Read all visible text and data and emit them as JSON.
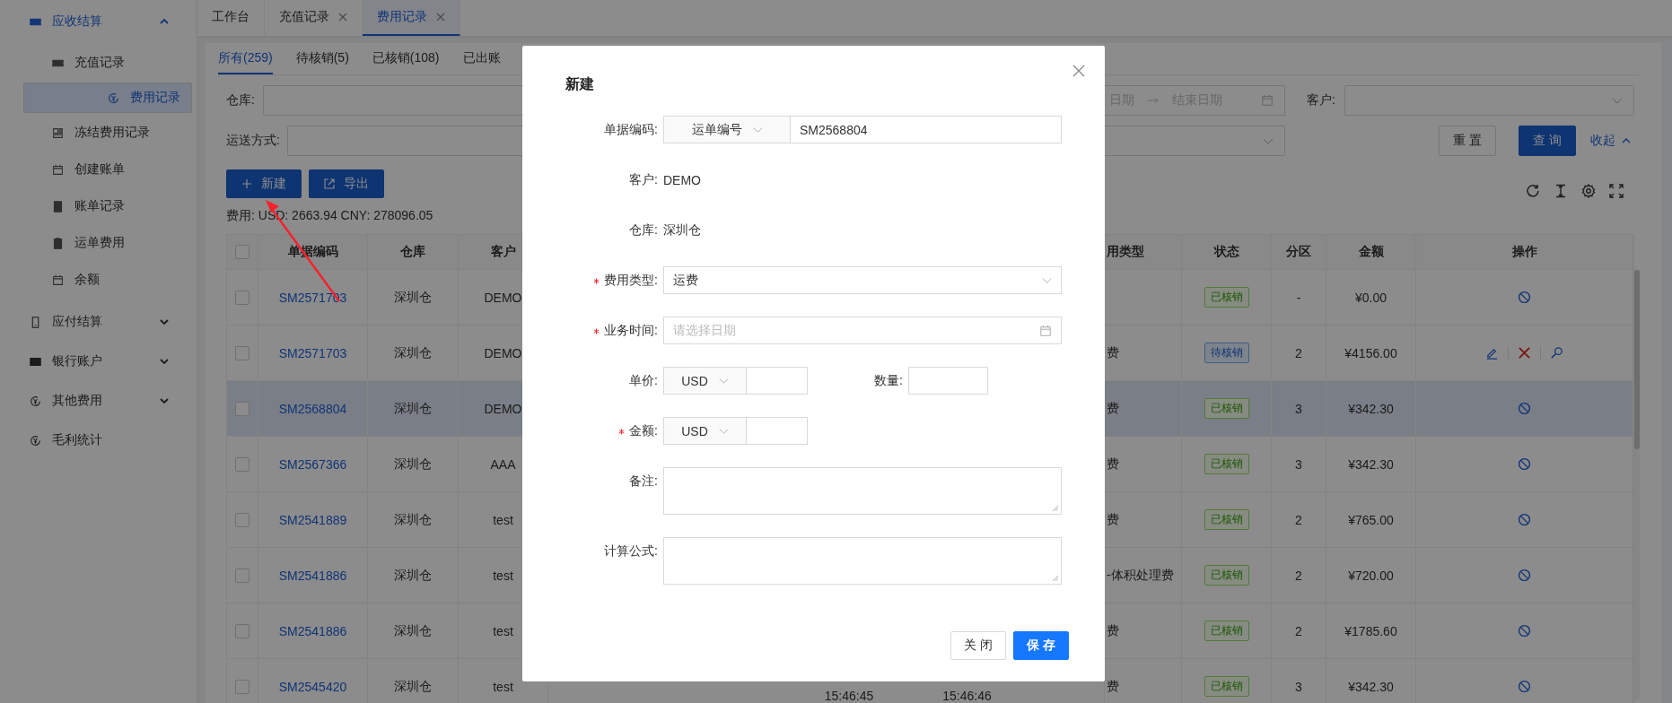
{
  "sidebar": {
    "groups": [
      {
        "label": "应收结算",
        "expanded": true,
        "children": [
          {
            "label": "充值记录",
            "selected": false
          },
          {
            "label": "费用记录",
            "selected": true
          },
          {
            "label": "冻结费用记录",
            "selected": false
          },
          {
            "label": "创建账单",
            "selected": false
          },
          {
            "label": "账单记录",
            "selected": false
          },
          {
            "label": "运单费用",
            "selected": false
          },
          {
            "label": "余额",
            "selected": false
          }
        ]
      },
      {
        "label": "应付结算",
        "expanded": false
      },
      {
        "label": "银行账户",
        "expanded": false
      },
      {
        "label": "其他费用",
        "expanded": false
      },
      {
        "label": "毛利统计"
      }
    ]
  },
  "tabs": [
    {
      "label": "工作台",
      "selected": false,
      "closable": false
    },
    {
      "label": "充值记录",
      "selected": false,
      "closable": true
    },
    {
      "label": "费用记录",
      "selected": true,
      "closable": true
    }
  ],
  "subtabs": [
    {
      "label": "所有(259)",
      "selected": true
    },
    {
      "label": "待核销(5)",
      "selected": false
    },
    {
      "label": "已核销(108)",
      "selected": false
    },
    {
      "label": "已出账",
      "selected": false
    }
  ],
  "filters": {
    "warehouse_label": "仓库:",
    "start_placeholder": "日期",
    "end_placeholder": "结束日期",
    "customer_label": "客户:",
    "shipping_label": "运送方式:",
    "reset": "重 置",
    "query": "查 询",
    "collapse": "收起"
  },
  "toolbar": {
    "new": "新建",
    "export": "导出"
  },
  "summary": "费用: USD: 2663.94 CNY: 278096.05",
  "table": {
    "all_checked": false,
    "columns": [
      "单据编码",
      "仓库",
      "客户",
      "用类型",
      "状态",
      "分区",
      "金额",
      "操作"
    ],
    "rows": [
      {
        "checked": false,
        "selected": false,
        "code": "SM2571703",
        "warehouse": "深圳仓",
        "customer": "DEMO",
        "fee_type": "",
        "status": {
          "label": "已核销",
          "kind": "verified"
        },
        "zone": "-",
        "amount": "¥0.00",
        "editable": false
      },
      {
        "checked": false,
        "selected": false,
        "code": "SM2571703",
        "warehouse": "深圳仓",
        "customer": "DEMO",
        "fee_type": "费",
        "status": {
          "label": "待核销",
          "kind": "pending"
        },
        "zone": "2",
        "amount": "¥4156.00",
        "editable": true
      },
      {
        "checked": false,
        "selected": true,
        "code": "SM2568804",
        "warehouse": "深圳仓",
        "customer": "DEMO",
        "fee_type": "费",
        "status": {
          "label": "已核销",
          "kind": "verified"
        },
        "zone": "3",
        "amount": "¥342.30",
        "editable": false
      },
      {
        "checked": false,
        "selected": false,
        "code": "SM2567366",
        "warehouse": "深圳仓",
        "customer": "AAA",
        "fee_type": "费",
        "status": {
          "label": "已核销",
          "kind": "verified"
        },
        "zone": "3",
        "amount": "¥342.30",
        "editable": false
      },
      {
        "checked": false,
        "selected": false,
        "code": "SM2541889",
        "warehouse": "深圳仓",
        "customer": "test",
        "fee_type": "费",
        "status": {
          "label": "已核销",
          "kind": "verified"
        },
        "zone": "2",
        "amount": "¥765.00",
        "editable": false
      },
      {
        "checked": false,
        "selected": false,
        "code": "SM2541886",
        "warehouse": "深圳仓",
        "customer": "test",
        "fee_type": "-体积处理费",
        "status": {
          "label": "已核销",
          "kind": "verified"
        },
        "zone": "2",
        "amount": "¥720.00",
        "editable": false
      },
      {
        "checked": false,
        "selected": false,
        "code": "SM2541886",
        "warehouse": "深圳仓",
        "customer": "test",
        "fee_type": "费",
        "status": {
          "label": "已核销",
          "kind": "verified"
        },
        "zone": "2",
        "amount": "¥1785.60",
        "editable": false
      },
      {
        "checked": false,
        "selected": false,
        "code": "SM2545420",
        "warehouse": "深圳仓",
        "customer": "test",
        "times": [
          "15:46:45",
          "15:46:46"
        ],
        "fee_type": "费",
        "status": {
          "label": "已核销",
          "kind": "verified"
        },
        "zone": "3",
        "amount": "¥342.30",
        "editable": false
      }
    ]
  },
  "modal": {
    "title": "新建",
    "fields": [
      {
        "kind": "code",
        "label": "单据编码:",
        "required": false,
        "prefix": "运单编号",
        "value": "SM2568804"
      },
      {
        "kind": "text",
        "label": "客户:",
        "required": false,
        "value": "DEMO"
      },
      {
        "kind": "text",
        "label": "仓库:",
        "required": false,
        "value": "深圳仓"
      },
      {
        "kind": "select",
        "label": "费用类型:",
        "required": true,
        "value": "运费"
      },
      {
        "kind": "date",
        "label": "业务时间:",
        "required": true,
        "placeholder": "请选择日期"
      },
      {
        "kind": "price",
        "label": "单价:",
        "required": false,
        "currency": "USD",
        "extra_label": "数量:"
      },
      {
        "kind": "money",
        "label": "金额:",
        "required": true,
        "currency": "USD"
      },
      {
        "kind": "textarea",
        "label": "备注:",
        "required": false
      },
      {
        "kind": "textarea",
        "label": "计算公式:",
        "required": false
      }
    ],
    "buttons": {
      "close": "关 闭",
      "save": "保 存"
    }
  }
}
